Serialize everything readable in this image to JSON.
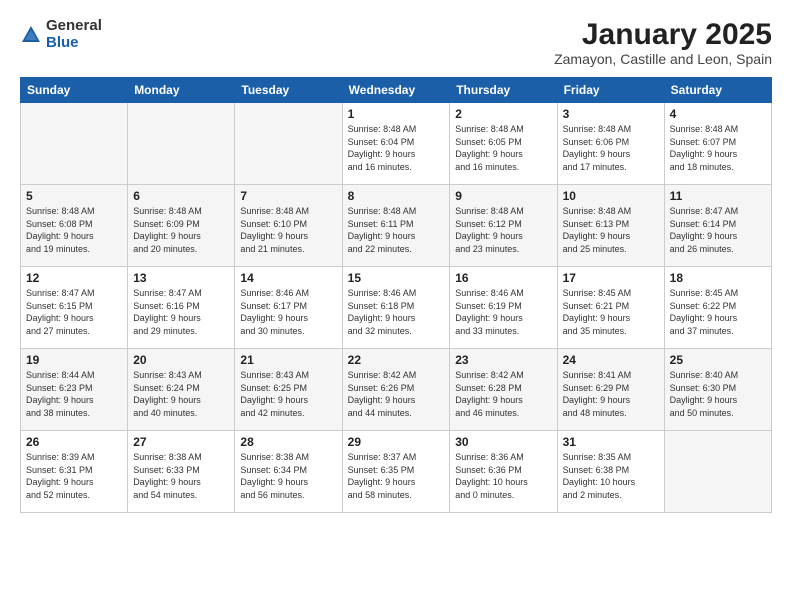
{
  "logo": {
    "general": "General",
    "blue": "Blue"
  },
  "title": "January 2025",
  "location": "Zamayon, Castille and Leon, Spain",
  "weekdays": [
    "Sunday",
    "Monday",
    "Tuesday",
    "Wednesday",
    "Thursday",
    "Friday",
    "Saturday"
  ],
  "weeks": [
    [
      {
        "day": "",
        "info": ""
      },
      {
        "day": "",
        "info": ""
      },
      {
        "day": "",
        "info": ""
      },
      {
        "day": "1",
        "info": "Sunrise: 8:48 AM\nSunset: 6:04 PM\nDaylight: 9 hours\nand 16 minutes."
      },
      {
        "day": "2",
        "info": "Sunrise: 8:48 AM\nSunset: 6:05 PM\nDaylight: 9 hours\nand 16 minutes."
      },
      {
        "day": "3",
        "info": "Sunrise: 8:48 AM\nSunset: 6:06 PM\nDaylight: 9 hours\nand 17 minutes."
      },
      {
        "day": "4",
        "info": "Sunrise: 8:48 AM\nSunset: 6:07 PM\nDaylight: 9 hours\nand 18 minutes."
      }
    ],
    [
      {
        "day": "5",
        "info": "Sunrise: 8:48 AM\nSunset: 6:08 PM\nDaylight: 9 hours\nand 19 minutes."
      },
      {
        "day": "6",
        "info": "Sunrise: 8:48 AM\nSunset: 6:09 PM\nDaylight: 9 hours\nand 20 minutes."
      },
      {
        "day": "7",
        "info": "Sunrise: 8:48 AM\nSunset: 6:10 PM\nDaylight: 9 hours\nand 21 minutes."
      },
      {
        "day": "8",
        "info": "Sunrise: 8:48 AM\nSunset: 6:11 PM\nDaylight: 9 hours\nand 22 minutes."
      },
      {
        "day": "9",
        "info": "Sunrise: 8:48 AM\nSunset: 6:12 PM\nDaylight: 9 hours\nand 23 minutes."
      },
      {
        "day": "10",
        "info": "Sunrise: 8:48 AM\nSunset: 6:13 PM\nDaylight: 9 hours\nand 25 minutes."
      },
      {
        "day": "11",
        "info": "Sunrise: 8:47 AM\nSunset: 6:14 PM\nDaylight: 9 hours\nand 26 minutes."
      }
    ],
    [
      {
        "day": "12",
        "info": "Sunrise: 8:47 AM\nSunset: 6:15 PM\nDaylight: 9 hours\nand 27 minutes."
      },
      {
        "day": "13",
        "info": "Sunrise: 8:47 AM\nSunset: 6:16 PM\nDaylight: 9 hours\nand 29 minutes."
      },
      {
        "day": "14",
        "info": "Sunrise: 8:46 AM\nSunset: 6:17 PM\nDaylight: 9 hours\nand 30 minutes."
      },
      {
        "day": "15",
        "info": "Sunrise: 8:46 AM\nSunset: 6:18 PM\nDaylight: 9 hours\nand 32 minutes."
      },
      {
        "day": "16",
        "info": "Sunrise: 8:46 AM\nSunset: 6:19 PM\nDaylight: 9 hours\nand 33 minutes."
      },
      {
        "day": "17",
        "info": "Sunrise: 8:45 AM\nSunset: 6:21 PM\nDaylight: 9 hours\nand 35 minutes."
      },
      {
        "day": "18",
        "info": "Sunrise: 8:45 AM\nSunset: 6:22 PM\nDaylight: 9 hours\nand 37 minutes."
      }
    ],
    [
      {
        "day": "19",
        "info": "Sunrise: 8:44 AM\nSunset: 6:23 PM\nDaylight: 9 hours\nand 38 minutes."
      },
      {
        "day": "20",
        "info": "Sunrise: 8:43 AM\nSunset: 6:24 PM\nDaylight: 9 hours\nand 40 minutes."
      },
      {
        "day": "21",
        "info": "Sunrise: 8:43 AM\nSunset: 6:25 PM\nDaylight: 9 hours\nand 42 minutes."
      },
      {
        "day": "22",
        "info": "Sunrise: 8:42 AM\nSunset: 6:26 PM\nDaylight: 9 hours\nand 44 minutes."
      },
      {
        "day": "23",
        "info": "Sunrise: 8:42 AM\nSunset: 6:28 PM\nDaylight: 9 hours\nand 46 minutes."
      },
      {
        "day": "24",
        "info": "Sunrise: 8:41 AM\nSunset: 6:29 PM\nDaylight: 9 hours\nand 48 minutes."
      },
      {
        "day": "25",
        "info": "Sunrise: 8:40 AM\nSunset: 6:30 PM\nDaylight: 9 hours\nand 50 minutes."
      }
    ],
    [
      {
        "day": "26",
        "info": "Sunrise: 8:39 AM\nSunset: 6:31 PM\nDaylight: 9 hours\nand 52 minutes."
      },
      {
        "day": "27",
        "info": "Sunrise: 8:38 AM\nSunset: 6:33 PM\nDaylight: 9 hours\nand 54 minutes."
      },
      {
        "day": "28",
        "info": "Sunrise: 8:38 AM\nSunset: 6:34 PM\nDaylight: 9 hours\nand 56 minutes."
      },
      {
        "day": "29",
        "info": "Sunrise: 8:37 AM\nSunset: 6:35 PM\nDaylight: 9 hours\nand 58 minutes."
      },
      {
        "day": "30",
        "info": "Sunrise: 8:36 AM\nSunset: 6:36 PM\nDaylight: 10 hours\nand 0 minutes."
      },
      {
        "day": "31",
        "info": "Sunrise: 8:35 AM\nSunset: 6:38 PM\nDaylight: 10 hours\nand 2 minutes."
      },
      {
        "day": "",
        "info": ""
      }
    ]
  ]
}
